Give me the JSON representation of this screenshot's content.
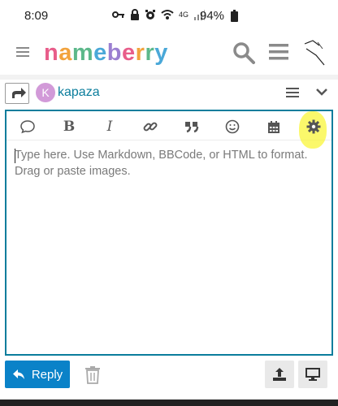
{
  "status_bar": {
    "time": "8:09",
    "network": "4G",
    "battery": "94%"
  },
  "header": {
    "logo_letters": [
      "n",
      "a",
      "m",
      "e",
      "b",
      "e",
      "r",
      "r",
      "y"
    ],
    "logo_colors": [
      "#e85d8a",
      "#f2a33c",
      "#5cb88a",
      "#4aa8d8",
      "#9b7fd1",
      "#e85d8a",
      "#f2a33c",
      "#5cb88a",
      "#4aa8d8"
    ]
  },
  "composer": {
    "user_initial": "K",
    "username": "kapaza",
    "placeholder": "Type here. Use Markdown, BBCode, or HTML to format. Drag or paste images."
  },
  "toolbar_icons": [
    "quote-icon",
    "bold-icon",
    "italic-icon",
    "link-icon",
    "blockquote-icon",
    "emoji-icon",
    "calendar-icon",
    "gear-icon"
  ],
  "footer": {
    "reply_label": "Reply"
  },
  "colors": {
    "accent": "#0a7d9c",
    "reply_button": "#0a82c8",
    "highlight": "#faf532"
  }
}
